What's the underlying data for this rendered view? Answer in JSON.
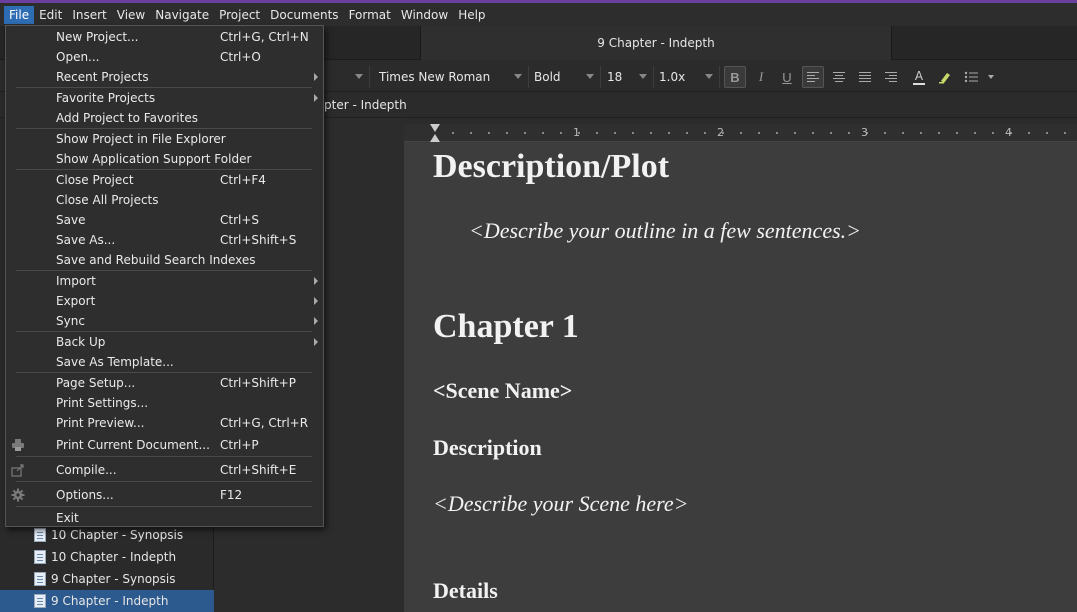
{
  "menubar": {
    "items": [
      "File",
      "Edit",
      "Insert",
      "View",
      "Navigate",
      "Project",
      "Documents",
      "Format",
      "Window",
      "Help"
    ]
  },
  "tab": {
    "title": "9 Chapter - Indepth"
  },
  "format": {
    "style": "",
    "font": "Times New Roman",
    "weight": "Bold",
    "size": "18",
    "spacing": "1.0x",
    "bold": "B",
    "italic": "I",
    "underline": "U",
    "font_color_icon": "A"
  },
  "header": {
    "title": "pter - Indepth"
  },
  "ruler": {
    "labels": [
      "1",
      "2",
      "3",
      "4"
    ]
  },
  "file_menu": {
    "items": [
      {
        "label": "New Project...",
        "shortcut": "Ctrl+G, Ctrl+N"
      },
      {
        "label": "Open...",
        "shortcut": "Ctrl+O"
      },
      {
        "label": "Recent Projects",
        "shortcut": "",
        "submenu": true
      },
      {
        "label": "Favorite Projects",
        "shortcut": "",
        "submenu": true
      },
      {
        "label": "Add Project to Favorites",
        "shortcut": ""
      },
      {
        "label": "Show Project in File Explorer",
        "shortcut": ""
      },
      {
        "label": "Show Application Support Folder",
        "shortcut": ""
      },
      {
        "label": "Close Project",
        "shortcut": "Ctrl+F4"
      },
      {
        "label": "Close All Projects",
        "shortcut": ""
      },
      {
        "label": "Save",
        "shortcut": "Ctrl+S"
      },
      {
        "label": "Save As...",
        "shortcut": "Ctrl+Shift+S"
      },
      {
        "label": "Save and Rebuild Search Indexes",
        "shortcut": ""
      },
      {
        "label": "Import",
        "shortcut": "",
        "submenu": true
      },
      {
        "label": "Export",
        "shortcut": "",
        "submenu": true
      },
      {
        "label": "Sync",
        "shortcut": "",
        "submenu": true
      },
      {
        "label": "Back Up",
        "shortcut": "",
        "submenu": true
      },
      {
        "label": "Save As Template...",
        "shortcut": ""
      },
      {
        "label": "Page Setup...",
        "shortcut": "Ctrl+Shift+P"
      },
      {
        "label": "Print Settings...",
        "shortcut": ""
      },
      {
        "label": "Print Preview...",
        "shortcut": "Ctrl+G, Ctrl+R"
      },
      {
        "label": "Print Current Document...",
        "shortcut": "Ctrl+P",
        "icon": "printer-icon"
      },
      {
        "label": "Compile...",
        "shortcut": "Ctrl+Shift+E",
        "icon": "compile-icon"
      },
      {
        "label": "Options...",
        "shortcut": "F12",
        "icon": "gear-icon"
      },
      {
        "label": "Exit",
        "shortcut": ""
      }
    ]
  },
  "binder": {
    "items": [
      {
        "label": "10 Chapter - Synopsis",
        "selected": false
      },
      {
        "label": "10 Chapter - Indepth",
        "selected": false
      },
      {
        "label": "9 Chapter - Synopsis",
        "selected": false
      },
      {
        "label": "9 Chapter - Indepth",
        "selected": true
      }
    ]
  },
  "editor": {
    "heading1": "Description/Plot",
    "outline_prompt": "<Describe your outline in a few sentences.>",
    "chapter_heading": "Chapter 1",
    "scene_name": "<Scene Name>",
    "description_heading": "Description",
    "scene_prompt": "<Describe your Scene here>",
    "details_heading": "Details"
  }
}
